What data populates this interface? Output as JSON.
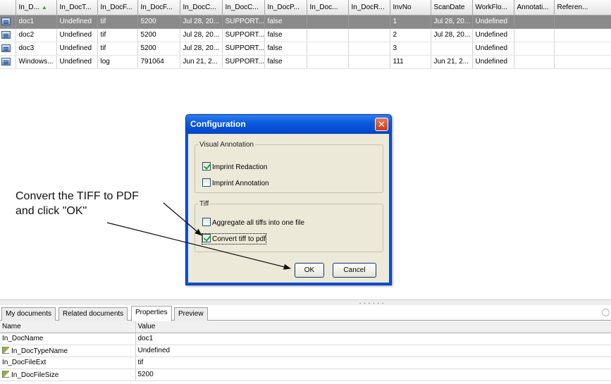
{
  "grid": {
    "columns": [
      "",
      "In_D...",
      "In_DocT...",
      "In_DocF...",
      "In_DocF...",
      "In_DocC...",
      "In_DocC...",
      "In_DocP...",
      "In_Doc...",
      "In_DocR...",
      "InvNo",
      "ScanDate",
      "WorkFlo...",
      "Annotati...",
      "Referen..."
    ],
    "rows": [
      [
        "doc1",
        "Undefined",
        "tif",
        "5200",
        "Jul 28, 20...",
        "SUPPORT...",
        "false",
        "",
        "",
        "1",
        "Jul 28, 20...",
        "Undefined",
        "",
        ""
      ],
      [
        "doc2",
        "Undefined",
        "tif",
        "5200",
        "Jul 28, 20...",
        "SUPPORT...",
        "false",
        "",
        "",
        "2",
        "Jul 28, 20...",
        "Undefined",
        "",
        ""
      ],
      [
        "doc3",
        "Undefined",
        "tif",
        "5200",
        "Jul 28, 20...",
        "SUPPORT...",
        "false",
        "",
        "",
        "3",
        "",
        "Undefined",
        "",
        ""
      ],
      [
        "Windows...",
        "Undefined",
        "log",
        "791064",
        "Jun 21, 2...",
        "SUPPORT...",
        "false",
        "",
        "",
        "111",
        "Jun 21, 2...",
        "Undefined",
        "",
        ""
      ]
    ],
    "selected_row": 0
  },
  "annotation": {
    "line1": "Convert the TIFF to PDF",
    "line2": "and click \"OK\""
  },
  "dialog": {
    "title": "Configuration",
    "close_glyph": "✕",
    "visual_annotation": {
      "legend": "Visual Annotation",
      "imprint_redaction": {
        "label": "Imprint Redaction",
        "checked": true
      },
      "imprint_annotation": {
        "label": "Imprint Annotation",
        "checked": false
      }
    },
    "tiff": {
      "legend": "Tiff",
      "aggregate": {
        "label": "Aggregate all tiffs into one file",
        "checked": false
      },
      "convert": {
        "label": "Convert tiff to pdf",
        "checked": true
      }
    },
    "ok_label": "OK",
    "cancel_label": "Cancel"
  },
  "splitter": {
    "grip": "• • • • • •"
  },
  "tabs": [
    {
      "label": "My documents",
      "active": false
    },
    {
      "label": "Related documents",
      "active": false
    },
    {
      "label": "Properties",
      "active": true
    },
    {
      "label": "Preview",
      "active": false
    }
  ],
  "properties": {
    "headers": {
      "name": "Name",
      "value": "Value"
    },
    "rows": [
      {
        "name": "In_DocName",
        "value": "doc1",
        "editable": false
      },
      {
        "name": "In_DocTypeName",
        "value": "Undefined",
        "editable": true
      },
      {
        "name": "In_DocFileExt",
        "value": "tif",
        "editable": false
      },
      {
        "name": "In_DocFileSize",
        "value": "5200",
        "editable": true
      }
    ]
  },
  "colors": {
    "selected_row": "#8a8a8a",
    "dialog_title": "#0a58dc",
    "dialog_body": "#ece9d8",
    "checkmark": "#21a121"
  }
}
